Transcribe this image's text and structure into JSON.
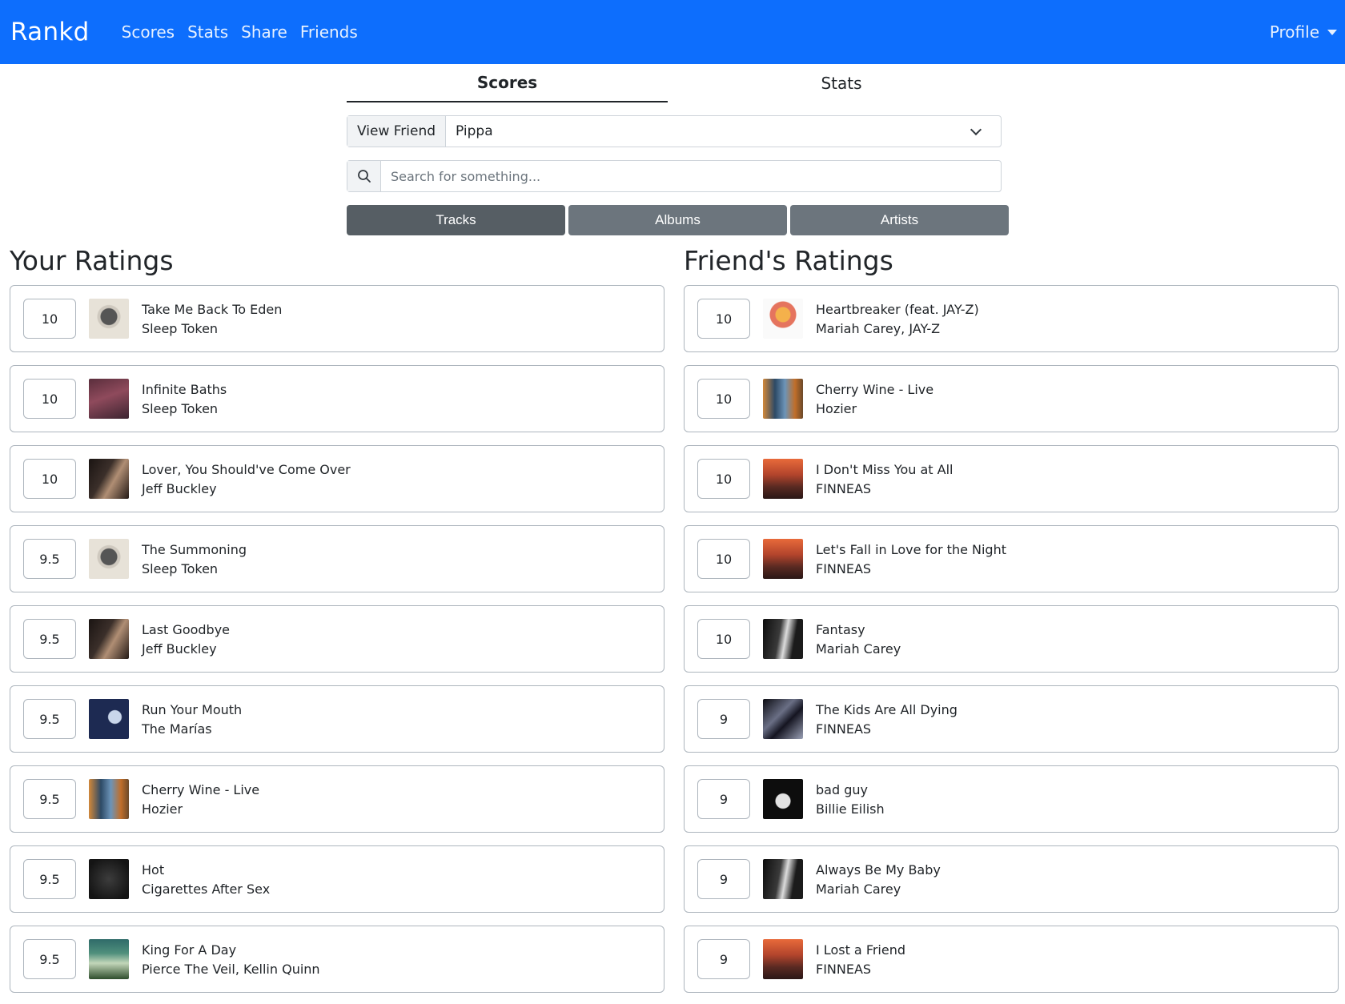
{
  "nav": {
    "brand": "Rankd",
    "links": [
      "Scores",
      "Stats",
      "Share",
      "Friends"
    ],
    "profile": "Profile"
  },
  "tabs": {
    "active": "Scores",
    "inactive": "Stats"
  },
  "friend_select": {
    "label": "View Friend",
    "value": "Pippa"
  },
  "search": {
    "placeholder": "Search for something..."
  },
  "type_buttons": {
    "tracks": "Tracks",
    "albums": "Albums",
    "artists": "Artists",
    "active": "Tracks"
  },
  "your_ratings": {
    "title": "Your Ratings",
    "items": [
      {
        "score": "10",
        "title": "Take Me Back To Eden",
        "artist": "Sleep Token",
        "art": "eden"
      },
      {
        "score": "10",
        "title": "Infinite Baths",
        "artist": "Sleep Token",
        "art": "baths"
      },
      {
        "score": "10",
        "title": "Lover, You Should've Come Over",
        "artist": "Jeff Buckley",
        "art": "buckley"
      },
      {
        "score": "9.5",
        "title": "The Summoning",
        "artist": "Sleep Token",
        "art": "eden"
      },
      {
        "score": "9.5",
        "title": "Last Goodbye",
        "artist": "Jeff Buckley",
        "art": "buckley"
      },
      {
        "score": "9.5",
        "title": "Run Your Mouth",
        "artist": "The Marías",
        "art": "marias"
      },
      {
        "score": "9.5",
        "title": "Cherry Wine - Live",
        "artist": "Hozier",
        "art": "hozier"
      },
      {
        "score": "9.5",
        "title": "Hot",
        "artist": "Cigarettes After Sex",
        "art": "cigs"
      },
      {
        "score": "9.5",
        "title": "King For A Day",
        "artist": "Pierce The Veil, Kellin Quinn",
        "art": "ptv"
      }
    ]
  },
  "friend_ratings": {
    "title": "Friend's Ratings",
    "items": [
      {
        "score": "10",
        "title": "Heartbreaker (feat. JAY-Z)",
        "artist": "Mariah Carey, JAY-Z",
        "art": "mariah-jay"
      },
      {
        "score": "10",
        "title": "Cherry Wine - Live",
        "artist": "Hozier",
        "art": "hozier"
      },
      {
        "score": "10",
        "title": "I Don't Miss You at All",
        "artist": "FINNEAS",
        "art": "finneas"
      },
      {
        "score": "10",
        "title": "Let's Fall in Love for the Night",
        "artist": "FINNEAS",
        "art": "finneas"
      },
      {
        "score": "10",
        "title": "Fantasy",
        "artist": "Mariah Carey",
        "art": "mariah"
      },
      {
        "score": "9",
        "title": "The Kids Are All Dying",
        "artist": "FINNEAS",
        "art": "kids"
      },
      {
        "score": "9",
        "title": "bad guy",
        "artist": "Billie Eilish",
        "art": "billie"
      },
      {
        "score": "9",
        "title": "Always Be My Baby",
        "artist": "Mariah Carey",
        "art": "mariah"
      },
      {
        "score": "9",
        "title": "I Lost a Friend",
        "artist": "FINNEAS",
        "art": "finneas"
      }
    ]
  },
  "colors": {
    "navbar": "#0d6efd",
    "button": "#6c757d",
    "button_active": "#565e64"
  }
}
